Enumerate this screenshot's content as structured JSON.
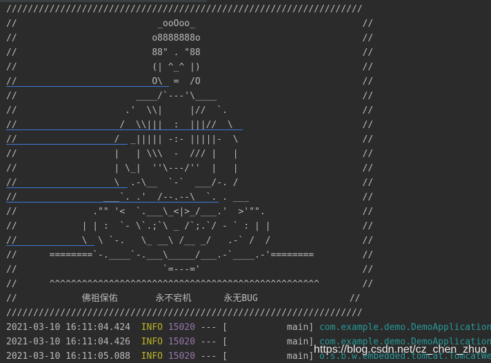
{
  "banner": {
    "lines": [
      "//////////////////////////////////////////////////////////////////",
      "//                          _ooOoo_                               //",
      "//                         o8888888o                              //",
      "//                         88\" . \"88                              //",
      "//                         (| ^_^ |)                              //",
      "//                         O\\  =  /O                              //",
      "//                      ____/`---'\\____                           //",
      "//                    .'  \\\\|     |//  `.                         //",
      "//                   /  \\\\|||  :  |||//  \\                        //",
      "//                  /  _||||| -:- |||||-  \\                       //",
      "//                  |   | \\\\\\  -  /// |   |                       //",
      "//                  | \\_|  ''\\---/''  |   |                       //",
      "//                  \\  .-\\__  `-`  ___/-. /                       //",
      "//                ___`. .'  /--.--\\  `. . ___                     //",
      "//              .\"\" '<  `.___\\_<|>_/___.'  >'\"\".                  //",
      "//            | | :  `- \\`.;`\\ _ /`;.`/ - ` : | |                 //",
      "//            \\  \\ `-.   \\_ __\\ /__ _/   .-` /  /                 //",
      "//      ========`-.____`-.___\\_____/___.-`____.-'========         //",
      "//                           `=---='                              //",
      "//      ^^^^^^^^^^^^^^^^^^^^^^^^^^^^^^^^^^^^^^^^^^^^^^^^^^        //",
      "//            佛祖保佑       永不宕机      永无BUG                 //",
      "//////////////////////////////////////////////////////////////////"
    ]
  },
  "log": [
    {
      "timestamp": "2021-03-10 16:11:04.424",
      "level": "INFO",
      "pid": "15020",
      "sep": "---",
      "thread": "[           main]",
      "logger": "com.example.demo.DemoApplication"
    },
    {
      "timestamp": "2021-03-10 16:11:04.426",
      "level": "INFO",
      "pid": "15020",
      "sep": "---",
      "thread": "[           main]",
      "logger": "com.example.demo.DemoApplication"
    },
    {
      "timestamp": "2021-03-10 16:11:05.088",
      "level": "INFO",
      "pid": "15020",
      "sep": "---",
      "thread": "[           main]",
      "logger": "o.s.b.w.embedded.tomcat.TomcatWebServer"
    }
  ],
  "watermark": "https://blog.csdn.net/cz_chen_zhuo",
  "colors": {
    "background": "#2b2b2b",
    "text": "#bbbbbb",
    "info": "#bbb529",
    "pid": "#9876aa",
    "logger": "#299999",
    "link_underline": "#3d7bd8"
  }
}
